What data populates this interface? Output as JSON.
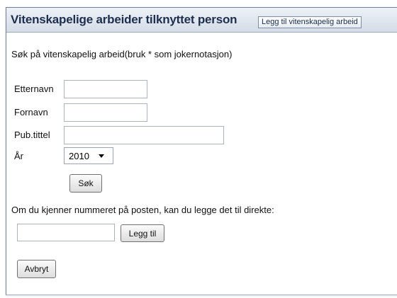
{
  "header": {
    "title": "Vitenskapelige arbeider tilknyttet person",
    "add_button": "Legg til vitenskapelig arbeid"
  },
  "search": {
    "intro": "Søk på vitenskapelig arbeid(bruk * som jokernotasjon)",
    "fields": {
      "etternavn": {
        "label": "Etternavn",
        "value": ""
      },
      "fornavn": {
        "label": "Fornavn",
        "value": ""
      },
      "pub_tittel": {
        "label": "Pub.tittel",
        "value": ""
      }
    },
    "year": {
      "label": "År",
      "selected": "2010"
    },
    "search_button": "Søk"
  },
  "direct": {
    "text": "Om du kjenner nummeret på posten, kan du legge det til direkte:",
    "value": "",
    "add_button": "Legg til"
  },
  "cancel_button": "Avbryt",
  "colors": {
    "header_text": "#1d2f4e",
    "header_bg_top": "#eef2f7",
    "header_bg_bottom": "#d4dce7"
  }
}
